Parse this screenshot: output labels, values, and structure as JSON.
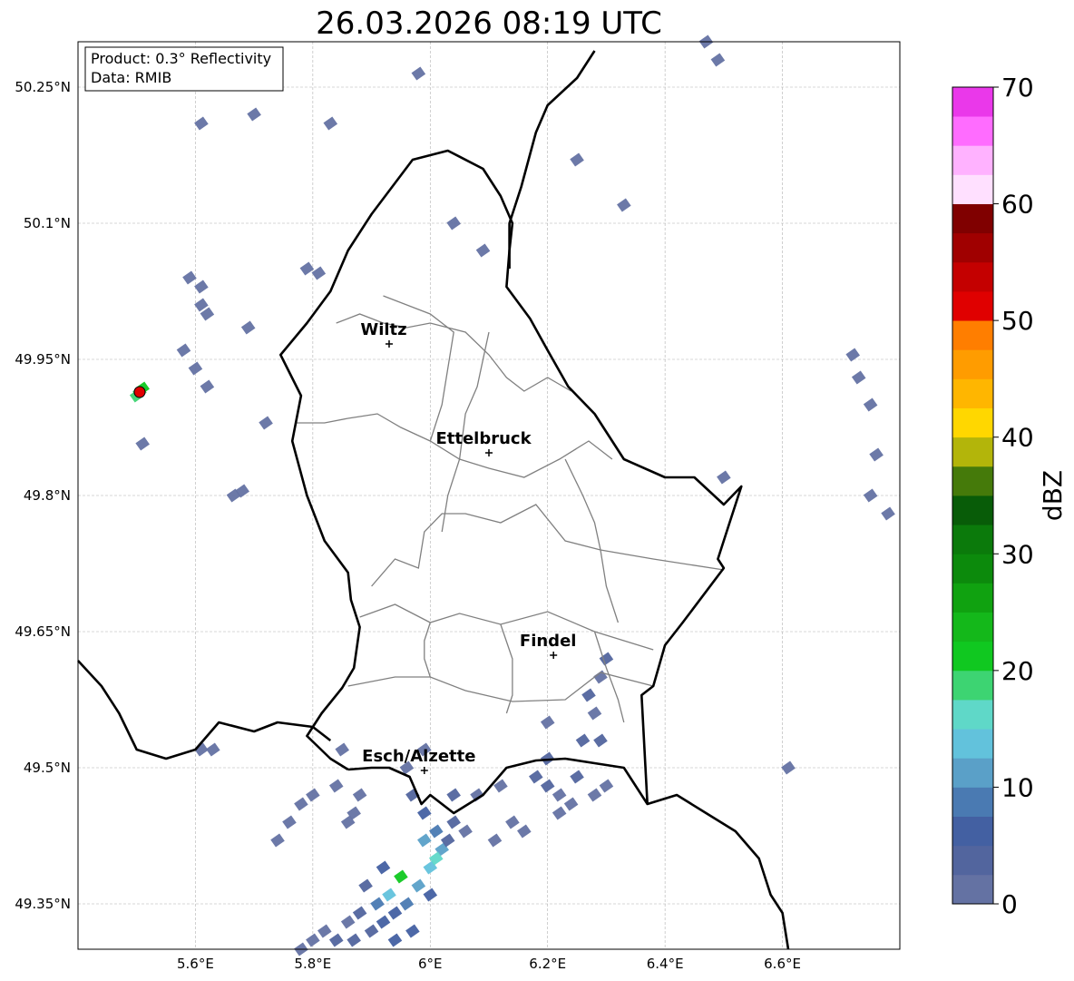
{
  "title": "26.03.2026 08:19 UTC",
  "info": {
    "product": "Product: 0.3° Reflectivity",
    "source": "Data: RMIB"
  },
  "extent": {
    "lon_min": 5.4,
    "lon_max": 6.8,
    "lat_min": 49.3,
    "lat_max": 50.3
  },
  "lon_ticks": [
    {
      "value": 5.6,
      "label": "5.6°E"
    },
    {
      "value": 5.8,
      "label": "5.8°E"
    },
    {
      "value": 6.0,
      "label": "6°E"
    },
    {
      "value": 6.2,
      "label": "6.2°E"
    },
    {
      "value": 6.4,
      "label": "6.4°E"
    },
    {
      "value": 6.6,
      "label": "6.6°E"
    }
  ],
  "lat_ticks": [
    {
      "value": 50.25,
      "label": "50.25°N"
    },
    {
      "value": 50.1,
      "label": "50.1°N"
    },
    {
      "value": 49.95,
      "label": "49.95°N"
    },
    {
      "value": 49.8,
      "label": "49.8°N"
    },
    {
      "value": 49.65,
      "label": "49.65°N"
    },
    {
      "value": 49.5,
      "label": "49.5°N"
    },
    {
      "value": 49.35,
      "label": "49.35°N"
    }
  ],
  "cities": [
    {
      "name": "Wiltz",
      "lon": 5.93,
      "lat": 49.967
    },
    {
      "name": "Ettelbruck",
      "lon": 6.1,
      "lat": 49.847
    },
    {
      "name": "Findel",
      "lon": 6.21,
      "lat": 49.624
    },
    {
      "name": "Esch/Alzette",
      "lon": 5.99,
      "lat": 49.497
    }
  ],
  "radar_site": {
    "lon": 5.505,
    "lat": 49.914,
    "color": "#e00000"
  },
  "borders": {
    "lux": [
      [
        5.86,
        49.498
      ],
      [
        5.83,
        49.51
      ],
      [
        5.79,
        49.535
      ],
      [
        5.815,
        49.56
      ],
      [
        5.85,
        49.588
      ],
      [
        5.87,
        49.61
      ],
      [
        5.88,
        49.655
      ],
      [
        5.865,
        49.685
      ],
      [
        5.86,
        49.715
      ],
      [
        5.82,
        49.75
      ],
      [
        5.79,
        49.8
      ],
      [
        5.765,
        49.86
      ],
      [
        5.78,
        49.91
      ],
      [
        5.745,
        49.955
      ],
      [
        5.79,
        49.99
      ],
      [
        5.83,
        50.025
      ],
      [
        5.86,
        50.07
      ],
      [
        5.9,
        50.11
      ],
      [
        5.97,
        50.17
      ],
      [
        6.03,
        50.18
      ],
      [
        6.09,
        50.16
      ],
      [
        6.12,
        50.13
      ],
      [
        6.14,
        50.1
      ],
      [
        6.135,
        50.07
      ],
      [
        6.13,
        50.03
      ],
      [
        6.17,
        49.995
      ],
      [
        6.2,
        49.96
      ],
      [
        6.235,
        49.92
      ],
      [
        6.28,
        49.89
      ],
      [
        6.33,
        49.84
      ],
      [
        6.4,
        49.82
      ],
      [
        6.45,
        49.82
      ],
      [
        6.5,
        49.79
      ],
      [
        6.53,
        49.81
      ],
      [
        6.51,
        49.77
      ],
      [
        6.49,
        49.73
      ],
      [
        6.5,
        49.72
      ],
      [
        6.43,
        49.66
      ],
      [
        6.4,
        49.635
      ],
      [
        6.38,
        49.59
      ],
      [
        6.36,
        49.58
      ],
      [
        6.37,
        49.46
      ],
      [
        6.33,
        49.5
      ],
      [
        6.28,
        49.505
      ],
      [
        6.23,
        49.51
      ],
      [
        6.18,
        49.508
      ],
      [
        6.13,
        49.5
      ],
      [
        6.09,
        49.47
      ],
      [
        6.04,
        49.45
      ],
      [
        6.0,
        49.47
      ],
      [
        5.985,
        49.46
      ],
      [
        5.965,
        49.49
      ],
      [
        5.93,
        49.5
      ],
      [
        5.9,
        49.5
      ],
      [
        5.86,
        49.498
      ]
    ],
    "de": [
      [
        6.28,
        50.29
      ],
      [
        6.25,
        50.26
      ],
      [
        6.2,
        50.23
      ],
      [
        6.18,
        50.2
      ],
      [
        6.155,
        50.14
      ],
      [
        6.135,
        50.1
      ],
      [
        6.135,
        50.05
      ]
    ],
    "fr": [
      [
        5.4,
        49.618
      ],
      [
        5.44,
        49.59
      ],
      [
        5.47,
        49.56
      ],
      [
        5.5,
        49.52
      ],
      [
        5.55,
        49.51
      ],
      [
        5.6,
        49.52
      ],
      [
        5.64,
        49.55
      ],
      [
        5.7,
        49.54
      ],
      [
        5.74,
        49.55
      ],
      [
        5.8,
        49.545
      ],
      [
        5.83,
        49.53
      ]
    ],
    "fr_de": [
      [
        6.37,
        49.46
      ],
      [
        6.42,
        49.47
      ],
      [
        6.47,
        49.45
      ],
      [
        6.52,
        49.43
      ],
      [
        6.56,
        49.4
      ],
      [
        6.58,
        49.36
      ],
      [
        6.6,
        49.34
      ],
      [
        6.61,
        49.3
      ]
    ]
  },
  "cantons": [
    [
      [
        5.86,
        49.59
      ],
      [
        5.94,
        49.6
      ],
      [
        6.0,
        49.6
      ],
      [
        6.06,
        49.585
      ],
      [
        6.14,
        49.573
      ],
      [
        6.23,
        49.575
      ],
      [
        6.29,
        49.605
      ],
      [
        6.38,
        49.59
      ]
    ],
    [
      [
        5.88,
        49.666
      ],
      [
        5.94,
        49.68
      ],
      [
        6.0,
        49.66
      ],
      [
        6.05,
        49.67
      ],
      [
        6.12,
        49.658
      ],
      [
        6.2,
        49.672
      ],
      [
        6.28,
        49.65
      ],
      [
        6.38,
        49.63
      ]
    ],
    [
      [
        5.9,
        49.7
      ],
      [
        5.94,
        49.73
      ],
      [
        5.98,
        49.72
      ],
      [
        5.99,
        49.76
      ],
      [
        6.02,
        49.78
      ],
      [
        6.06,
        49.78
      ],
      [
        6.12,
        49.77
      ],
      [
        6.18,
        49.79
      ],
      [
        6.23,
        49.75
      ],
      [
        6.29,
        49.74
      ],
      [
        6.38,
        49.73
      ],
      [
        6.5,
        49.718
      ]
    ],
    [
      [
        5.77,
        49.88
      ],
      [
        5.82,
        49.88
      ],
      [
        5.86,
        49.885
      ],
      [
        5.91,
        49.89
      ],
      [
        5.95,
        49.875
      ],
      [
        6.0,
        49.86
      ],
      [
        6.05,
        49.84
      ],
      [
        6.1,
        49.83
      ],
      [
        6.16,
        49.82
      ],
      [
        6.22,
        49.84
      ],
      [
        6.27,
        49.86
      ],
      [
        6.31,
        49.84
      ]
    ],
    [
      [
        5.84,
        49.99
      ],
      [
        5.88,
        50.0
      ],
      [
        5.92,
        49.99
      ],
      [
        5.96,
        49.985
      ],
      [
        6.0,
        49.99
      ],
      [
        6.06,
        49.98
      ],
      [
        6.1,
        49.955
      ],
      [
        6.13,
        49.93
      ],
      [
        6.16,
        49.915
      ],
      [
        6.2,
        49.93
      ],
      [
        6.24,
        49.915
      ]
    ],
    [
      [
        5.92,
        50.02
      ],
      [
        5.96,
        50.01
      ],
      [
        6.0,
        50.0
      ],
      [
        6.04,
        49.98
      ],
      [
        6.03,
        49.94
      ],
      [
        6.02,
        49.9
      ],
      [
        6.0,
        49.86
      ]
    ],
    [
      [
        6.1,
        49.98
      ],
      [
        6.09,
        49.95
      ],
      [
        6.08,
        49.92
      ],
      [
        6.06,
        49.89
      ],
      [
        6.05,
        49.84
      ],
      [
        6.03,
        49.8
      ],
      [
        6.02,
        49.76
      ]
    ],
    [
      [
        6.23,
        49.84
      ],
      [
        6.26,
        49.8
      ],
      [
        6.28,
        49.77
      ],
      [
        6.29,
        49.74
      ],
      [
        6.3,
        49.7
      ],
      [
        6.32,
        49.66
      ]
    ],
    [
      [
        6.12,
        49.658
      ],
      [
        6.14,
        49.62
      ],
      [
        6.14,
        49.58
      ],
      [
        6.13,
        49.56
      ]
    ],
    [
      [
        6.28,
        49.65
      ],
      [
        6.3,
        49.61
      ],
      [
        6.32,
        49.575
      ],
      [
        6.33,
        49.55
      ]
    ],
    [
      [
        6.0,
        49.6
      ],
      [
        5.99,
        49.62
      ],
      [
        5.99,
        49.64
      ],
      [
        6.0,
        49.66
      ]
    ]
  ],
  "radar_echoes": [
    [
      5.97,
      49.47,
      3
    ],
    [
      5.99,
      49.45,
      5
    ],
    [
      6.01,
      49.43,
      8
    ],
    [
      6.02,
      49.41,
      12
    ],
    [
      6.0,
      49.39,
      14
    ],
    [
      5.98,
      49.37,
      10
    ],
    [
      5.96,
      49.35,
      8
    ],
    [
      5.94,
      49.34,
      6
    ],
    [
      5.92,
      49.33,
      5
    ],
    [
      5.9,
      49.32,
      4
    ],
    [
      5.88,
      49.34,
      3
    ],
    [
      5.86,
      49.33,
      2
    ],
    [
      5.84,
      49.31,
      3
    ],
    [
      5.82,
      49.32,
      2
    ],
    [
      5.8,
      49.31,
      1
    ],
    [
      5.78,
      49.3,
      2
    ],
    [
      5.95,
      49.38,
      21
    ],
    [
      6.01,
      49.4,
      16
    ],
    [
      5.93,
      49.36,
      13
    ],
    [
      5.97,
      49.32,
      6
    ],
    [
      5.91,
      49.35,
      9
    ],
    [
      6.03,
      49.42,
      4
    ],
    [
      5.89,
      49.37,
      3
    ],
    [
      5.94,
      49.31,
      5
    ],
    [
      6.0,
      49.36,
      7
    ],
    [
      5.87,
      49.31,
      4
    ],
    [
      5.99,
      49.42,
      11
    ],
    [
      6.04,
      49.44,
      3
    ],
    [
      5.92,
      49.39,
      6
    ],
    [
      5.8,
      49.47,
      2
    ],
    [
      5.78,
      49.46,
      2
    ],
    [
      5.84,
      49.48,
      1
    ],
    [
      5.76,
      49.44,
      1
    ],
    [
      5.74,
      49.42,
      2
    ],
    [
      5.85,
      49.52,
      1
    ],
    [
      5.88,
      49.47,
      2
    ],
    [
      5.86,
      49.44,
      1
    ],
    [
      6.04,
      49.47,
      3
    ],
    [
      6.08,
      49.47,
      2
    ],
    [
      6.12,
      49.48,
      2
    ],
    [
      6.06,
      49.43,
      2
    ],
    [
      6.11,
      49.42,
      1
    ],
    [
      6.14,
      49.44,
      1
    ],
    [
      6.16,
      49.43,
      2
    ],
    [
      6.18,
      49.49,
      3
    ],
    [
      6.2,
      49.48,
      4
    ],
    [
      6.22,
      49.47,
      2
    ],
    [
      6.25,
      49.49,
      3
    ],
    [
      6.28,
      49.47,
      2
    ],
    [
      6.26,
      49.53,
      4
    ],
    [
      6.29,
      49.53,
      3
    ],
    [
      6.28,
      49.56,
      2
    ],
    [
      6.27,
      49.58,
      3
    ],
    [
      6.29,
      49.6,
      2
    ],
    [
      6.3,
      49.62,
      3
    ],
    [
      6.2,
      49.55,
      1
    ],
    [
      6.2,
      49.51,
      3
    ],
    [
      6.22,
      49.45,
      2
    ],
    [
      6.24,
      49.46,
      1
    ],
    [
      6.3,
      49.48,
      1
    ],
    [
      5.505,
      49.914,
      19
    ],
    [
      5.51,
      49.918,
      22
    ],
    [
      5.5,
      49.91,
      18
    ],
    [
      5.68,
      49.805,
      1
    ],
    [
      5.665,
      49.8,
      1
    ],
    [
      5.72,
      49.88,
      1
    ],
    [
      5.61,
      50.01,
      1
    ],
    [
      5.62,
      50.0,
      1
    ],
    [
      5.59,
      50.04,
      1
    ],
    [
      5.61,
      50.03,
      1
    ],
    [
      5.6,
      49.94,
      1
    ],
    [
      5.62,
      49.92,
      1
    ],
    [
      5.58,
      49.96,
      1
    ],
    [
      5.61,
      50.21,
      1
    ],
    [
      5.7,
      50.22,
      1
    ],
    [
      5.83,
      50.21,
      1
    ],
    [
      5.98,
      50.265,
      1
    ],
    [
      5.79,
      50.05,
      1
    ],
    [
      5.81,
      50.045,
      1
    ],
    [
      5.69,
      49.985,
      1
    ],
    [
      5.51,
      49.857,
      1
    ],
    [
      6.04,
      50.1,
      1
    ],
    [
      6.09,
      50.07,
      1
    ],
    [
      6.25,
      50.17,
      1
    ],
    [
      6.33,
      50.12,
      1
    ],
    [
      6.47,
      50.3,
      1
    ],
    [
      6.49,
      50.28,
      1
    ],
    [
      6.72,
      49.955,
      2
    ],
    [
      6.73,
      49.93,
      1
    ],
    [
      6.75,
      49.9,
      1
    ],
    [
      6.76,
      49.845,
      1
    ],
    [
      6.75,
      49.8,
      1
    ],
    [
      6.78,
      49.78,
      1
    ],
    [
      6.5,
      49.82,
      1
    ],
    [
      6.61,
      49.5,
      1
    ],
    [
      5.87,
      49.45,
      1
    ],
    [
      5.63,
      49.52,
      1
    ],
    [
      5.61,
      49.52,
      1
    ],
    [
      5.96,
      49.5,
      1
    ],
    [
      5.99,
      49.52,
      1
    ]
  ],
  "colorbar": {
    "label": "dBZ",
    "vmin": 0,
    "vmax": 70,
    "ticks": [
      0,
      10,
      20,
      30,
      40,
      50,
      60,
      70
    ],
    "colors": [
      "#6472a3",
      "#52659e",
      "#4360a2",
      "#4a7ab2",
      "#5aa0c8",
      "#62c2dc",
      "#5fd8c8",
      "#3dd472",
      "#10c820",
      "#14b81a",
      "#10a210",
      "#0c8a0c",
      "#0b7a0b",
      "#085c08",
      "#457a0a",
      "#b3b50a",
      "#ffd700",
      "#ffb600",
      "#ff9c00",
      "#ff7e00",
      "#e00000",
      "#c40000",
      "#a00000",
      "#800000",
      "#ffe0ff",
      "#ffb2ff",
      "#ff6cff",
      "#ea38ea"
    ]
  }
}
